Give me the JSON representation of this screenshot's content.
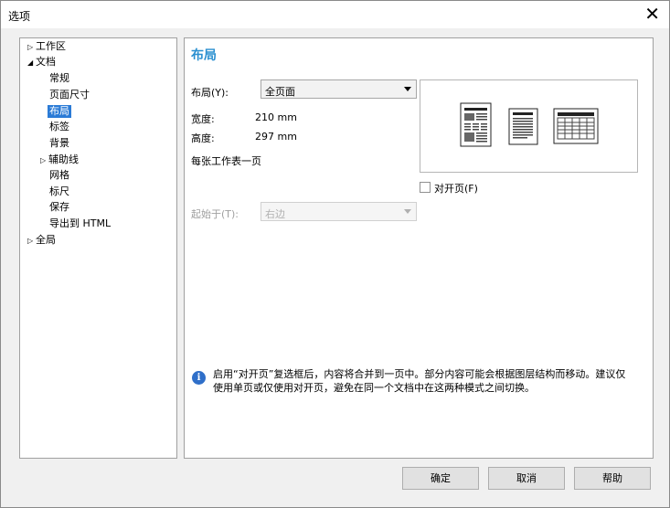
{
  "window": {
    "title": "选项",
    "close_glyph": "✕"
  },
  "tree": {
    "items": [
      {
        "label": "工作区",
        "arrow": "▷"
      },
      {
        "label": "文档",
        "arrow": "◢"
      },
      {
        "label": "常规"
      },
      {
        "label": "页面尺寸"
      },
      {
        "label": "布局",
        "selected": true
      },
      {
        "label": "标签"
      },
      {
        "label": "背景"
      },
      {
        "label": "辅助线",
        "arrow": "▷"
      },
      {
        "label": "网格"
      },
      {
        "label": "标尺"
      },
      {
        "label": "保存"
      },
      {
        "label": "导出到 HTML"
      },
      {
        "label": "全局",
        "arrow": "▷"
      }
    ]
  },
  "panel": {
    "heading": "布局",
    "layout_label": "布局(Y):",
    "layout_value": "全页面",
    "width_label": "宽度:",
    "width_value": "210 mm",
    "height_label": "高度:",
    "height_value": "297 mm",
    "per_sheet": "每张工作表一页",
    "facing_label": "对开页(F)",
    "start_label": "起始于(T):",
    "start_value": "右边",
    "info_text": "启用“对开页”复选框后，内容将合并到一页中。部分内容可能会根据图层结构而移动。建议仅使用单页或仅使用对开页，避免在同一个文档中在这两种模式之间切换。"
  },
  "buttons": {
    "ok": "确定",
    "cancel": "取消",
    "help": "帮助"
  },
  "colors": {
    "accent": "#2a8fd0",
    "selection": "#2b7bd6"
  },
  "icons": {
    "info": "info-icon",
    "close": "close-icon"
  }
}
